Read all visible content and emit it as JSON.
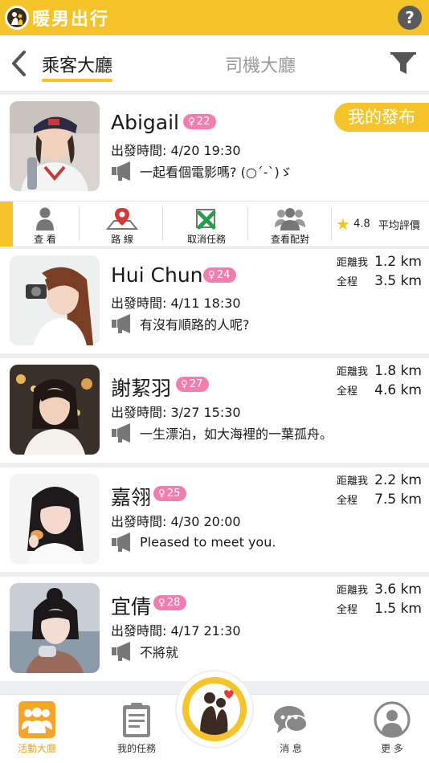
{
  "app": {
    "title": "暖男出行",
    "help_label": "?"
  },
  "tabs": {
    "passenger": "乘客大廳",
    "driver": "司機大廳"
  },
  "my_post": {
    "name": "Abigail",
    "age": "22",
    "depart": "出發時間: 4/20 19:30",
    "message": "一起看個電影嗎? (○´-`)ゞ",
    "badge": "我的發布",
    "actions": {
      "view": "查 看",
      "route": "路 線",
      "cancel": "取消任務",
      "match": "查看配對",
      "rating_value": "4.8",
      "rating_label": "平均評價"
    }
  },
  "distance_labels": {
    "to_me": "距離我",
    "total": "全程"
  },
  "posts": [
    {
      "name": "Hui Chun",
      "age": "24",
      "depart": "出發時間: 4/11 18:30",
      "message": "有沒有順路的人呢?",
      "to_me": "1.2 km",
      "total": "3.5 km"
    },
    {
      "name": "謝絜羽",
      "age": "27",
      "depart": "出發時間: 3/27 15:30",
      "message": "一生漂泊，如大海裡的一葉孤舟。",
      "to_me": "1.8 km",
      "total": "4.6 km"
    },
    {
      "name": "嘉翎",
      "age": "25",
      "depart": "出發時間: 4/30 20:00",
      "message": "Pleased to meet you.",
      "to_me": "2.2 km",
      "total": "7.5 km"
    },
    {
      "name": "宜倩",
      "age": "28",
      "depart": "出發時間: 4/17 21:30",
      "message": "不將就",
      "to_me": "3.6 km",
      "total": "1.5 km"
    }
  ],
  "nav": {
    "lobby": "活動大廳",
    "tasks": "我的任務",
    "messages": "消 息",
    "more": "更 多"
  },
  "colors": {
    "accent": "#f4c42a",
    "badge": "#f27eb0"
  }
}
